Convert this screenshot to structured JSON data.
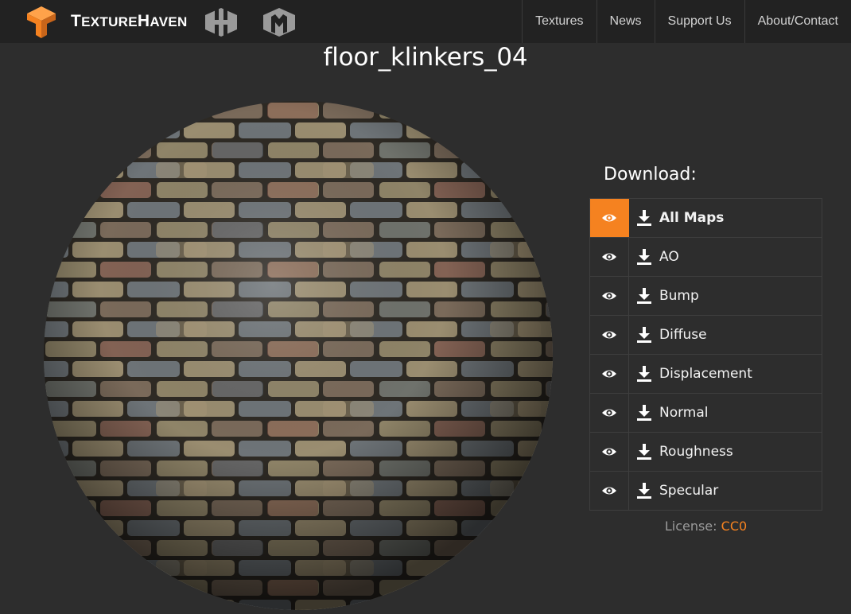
{
  "navbar": {
    "brand_parts": [
      "T",
      "EXTURE",
      "H",
      "AVEN"
    ],
    "site_icons": [
      "hdri-haven-icon",
      "3d-model-haven-icon"
    ],
    "links": [
      "Textures",
      "News",
      "Support Us",
      "About/Contact"
    ]
  },
  "page": {
    "title": "floor_klinkers_04"
  },
  "download": {
    "heading": "Download:",
    "items": [
      {
        "label": "All Maps",
        "active": true
      },
      {
        "label": "AO",
        "active": false
      },
      {
        "label": "Bump",
        "active": false
      },
      {
        "label": "Diffuse",
        "active": false
      },
      {
        "label": "Displacement",
        "active": false
      },
      {
        "label": "Normal",
        "active": false
      },
      {
        "label": "Roughness",
        "active": false
      },
      {
        "label": "Specular",
        "active": false
      }
    ]
  },
  "license": {
    "label": "License:",
    "value": "CC0"
  },
  "colors": {
    "accent": "#f58220",
    "background": "#2d2d2d",
    "navbar": "#222222",
    "icon_gray": "#9a9a9a"
  }
}
